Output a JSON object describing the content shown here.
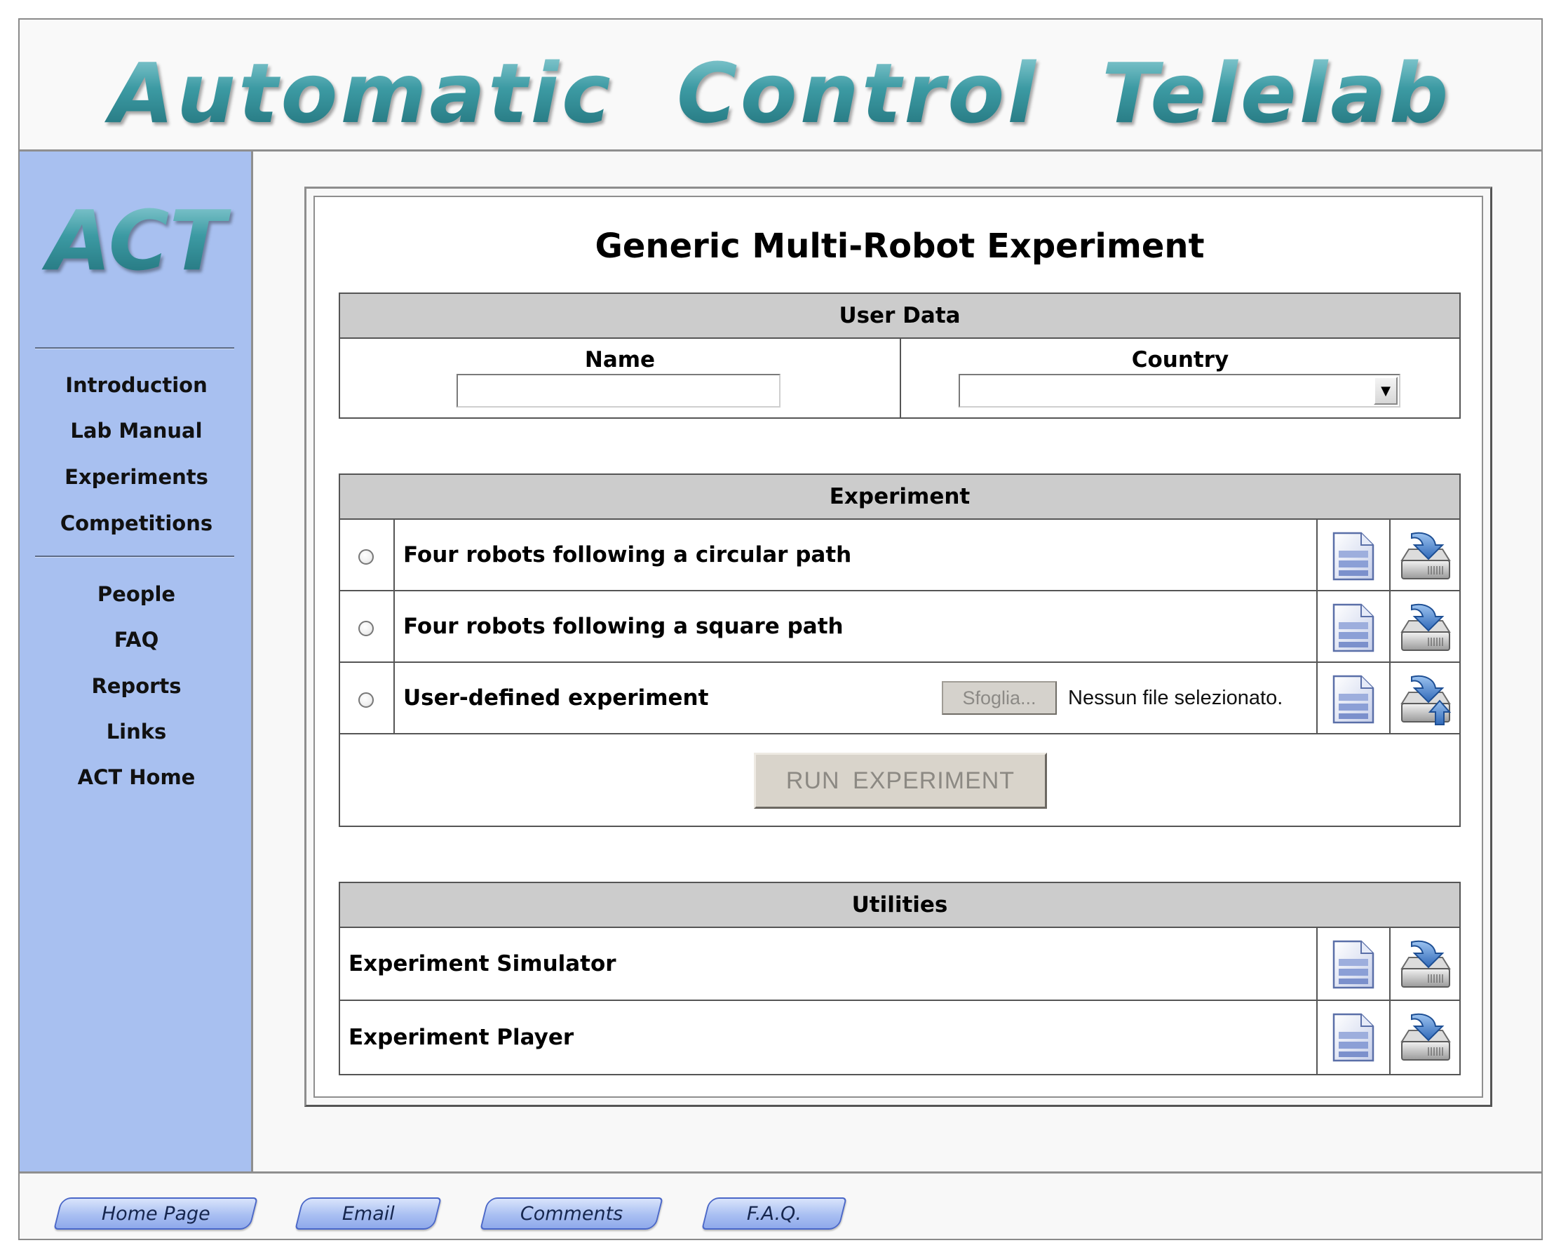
{
  "header": {
    "title": "Automatic  Control  Telelab"
  },
  "sidebar": {
    "logo": "ACT",
    "primary_nav": [
      "Introduction",
      "Lab Manual",
      "Experiments",
      "Competitions"
    ],
    "secondary_nav": [
      "People",
      "FAQ",
      "Reports",
      "Links",
      "ACT Home"
    ]
  },
  "main": {
    "title": "Generic Multi-Robot Experiment",
    "user_data": {
      "header": "User Data",
      "name_label": "Name",
      "name_value": "",
      "country_label": "Country",
      "country_value": ""
    },
    "experiment": {
      "header": "Experiment",
      "options": [
        {
          "label": "Four robots following a circular path"
        },
        {
          "label": "Four robots following a square path"
        },
        {
          "label": "User-defined experiment"
        }
      ],
      "browse_label": "Sfoglia...",
      "file_status": "Nessun file selezionato.",
      "run_label": "RUN  EXPERIMENT"
    },
    "utilities": {
      "header": "Utilities",
      "items": [
        {
          "label": "Experiment Simulator"
        },
        {
          "label": "Experiment Player"
        }
      ]
    }
  },
  "footer": {
    "buttons": [
      "Home Page",
      "Email",
      "Comments",
      "F.A.Q."
    ]
  },
  "icons": {
    "document": "document-icon",
    "download": "download-icon",
    "upload": "upload-icon",
    "dropdown": "chevron-down-icon"
  },
  "colors": {
    "sidebar_bg": "#a8c0f0",
    "table_header_bg": "#cccccc",
    "title_teal": "#2e8a94",
    "footer_button_bg": "#a9bff2"
  }
}
